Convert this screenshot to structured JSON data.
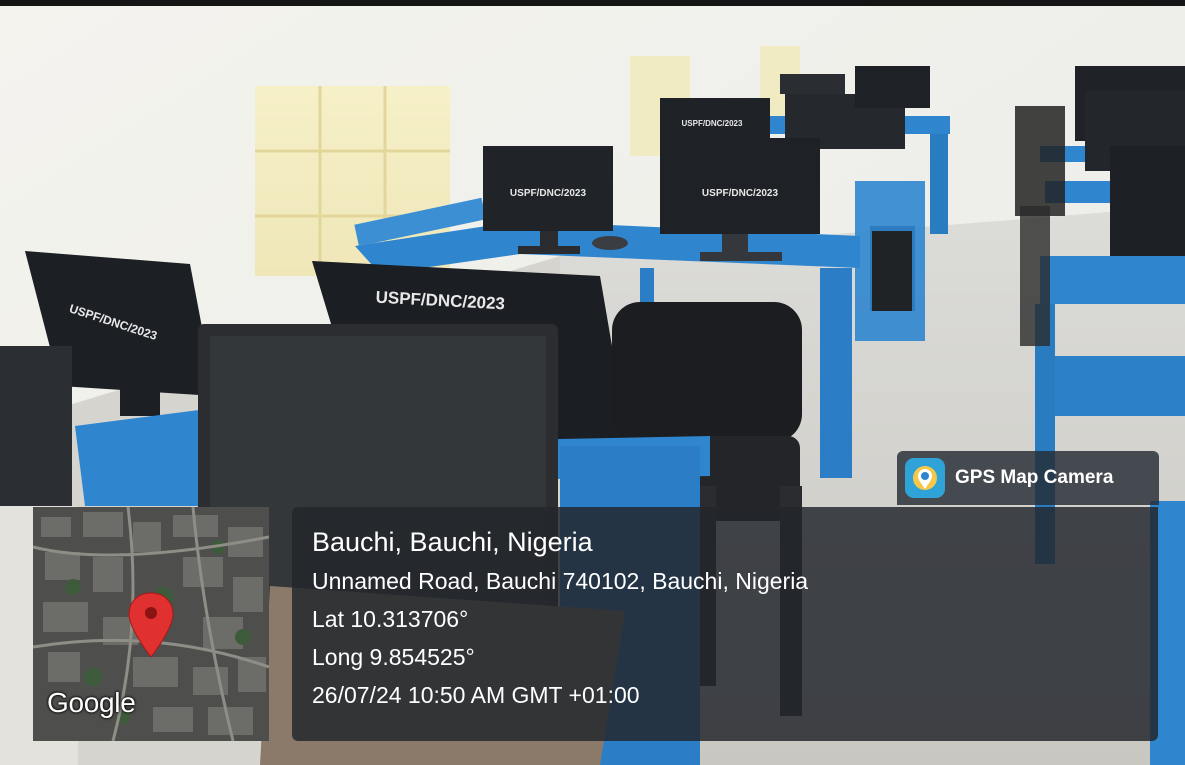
{
  "photo": {
    "description_icons": [
      "classroom-photo",
      "map-pin-icon",
      "gps-camera-app-icon"
    ],
    "monitor_labels": [
      "USPF/DNC/2023",
      "USPF/DNC/2023",
      "USPF/DNC/2023",
      "USPF/DNC/2023",
      "USPF/DNC/2023"
    ]
  },
  "badge": {
    "app_name": "GPS Map Camera"
  },
  "map": {
    "provider": "Google"
  },
  "location": {
    "place": "Bauchi, Bauchi, Nigeria",
    "address": "Unnamed Road, Bauchi 740102, Bauchi, Nigeria",
    "latitude": "Lat 10.313706°",
    "longitude": "Long 9.854525°",
    "timestamp": "26/07/24 10:50 AM GMT +01:00"
  },
  "colors": {
    "desk_blue": "#2f86cf",
    "overlay": "#22262c",
    "pin_red": "#e03030"
  }
}
